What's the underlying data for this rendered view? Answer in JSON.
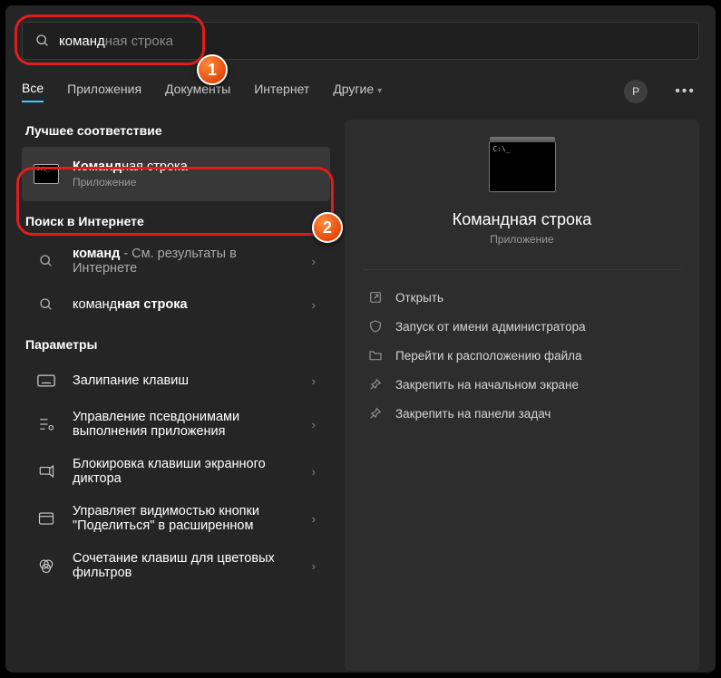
{
  "search": {
    "typed": "команд",
    "completion": "ная строка"
  },
  "tabs": {
    "all": "Все",
    "apps": "Приложения",
    "docs": "Документы",
    "internet": "Интернет",
    "more": "Другие"
  },
  "user_initial": "P",
  "sections": {
    "best_match": "Лучшее соответствие",
    "web": "Поиск в Интернете",
    "settings": "Параметры"
  },
  "best": {
    "title_hl": "Команд",
    "title_rest": "ная строка",
    "sub": "Приложение"
  },
  "web_results": [
    {
      "typed": "команд",
      "rest": " - См. результаты в Интернете"
    },
    {
      "typed": "команд",
      "rest_hl": "ная строка"
    }
  ],
  "settings_results": [
    "Залипание клавиш",
    "Управление псевдонимами выполнения приложения",
    "Блокировка клавиши экранного диктора",
    "Управляет видимостью кнопки \"Поделиться\" в расширенном",
    "Сочетание клавиш для цветовых фильтров"
  ],
  "preview": {
    "title": "Командная строка",
    "sub": "Приложение",
    "actions": [
      "Открыть",
      "Запуск от имени администратора",
      "Перейти к расположению файла",
      "Закрепить на начальном экране",
      "Закрепить на панели задач"
    ]
  },
  "badges": {
    "one": "1",
    "two": "2"
  }
}
